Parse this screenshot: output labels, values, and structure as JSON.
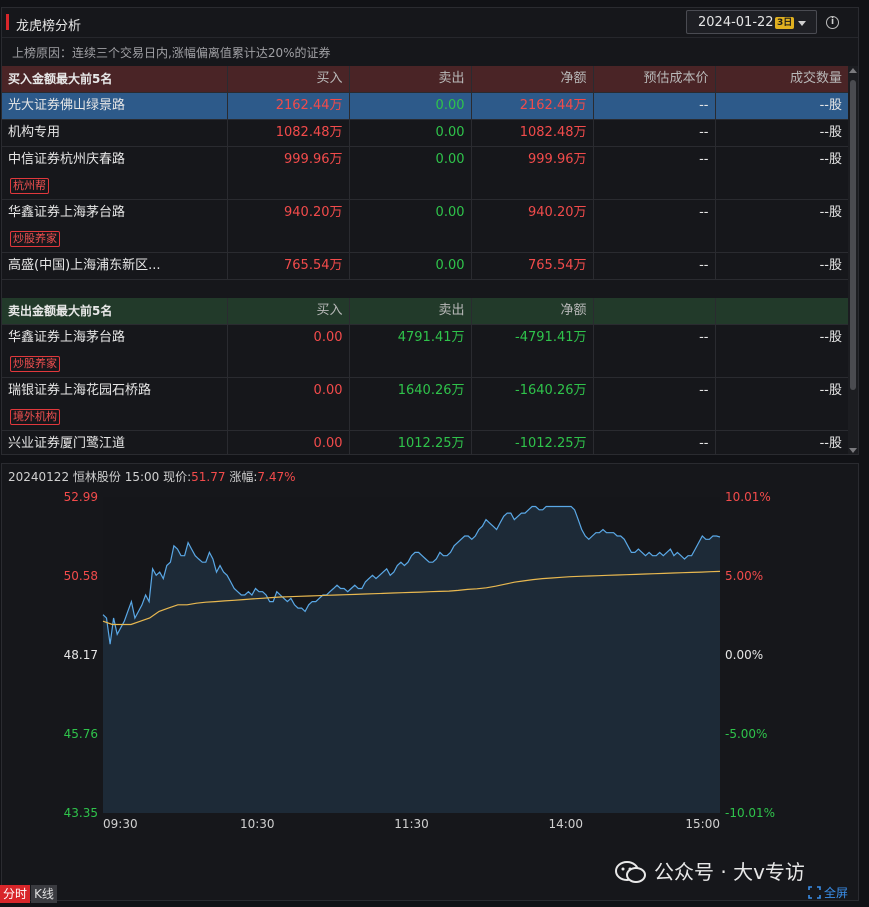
{
  "header": {
    "title": "龙虎榜分析",
    "date": "2024-01-22",
    "days_badge": "3日",
    "info_icon": "info-icon"
  },
  "reason": "上榜原因：连续三个交易日内,涨幅偏离值累计达20%的证券",
  "buy_table": {
    "columns": [
      "买入金额最大前5名",
      "买入",
      "卖出",
      "净额",
      "预估成本价",
      "成交数量"
    ],
    "rows": [
      {
        "name": "光大证券佛山绿景路",
        "tag": "",
        "buy": "2162.44万",
        "sell": "0.00",
        "net": "2162.44万",
        "cost": "--",
        "volume": "--股",
        "selected": true
      },
      {
        "name": "机构专用",
        "tag": "",
        "buy": "1082.48万",
        "sell": "0.00",
        "net": "1082.48万",
        "cost": "--",
        "volume": "--股",
        "selected": false
      },
      {
        "name": "中信证券杭州庆春路",
        "tag": "杭州帮",
        "buy": "999.96万",
        "sell": "0.00",
        "net": "999.96万",
        "cost": "--",
        "volume": "--股",
        "selected": false
      },
      {
        "name": "华鑫证券上海茅台路",
        "tag": "炒股养家",
        "buy": "940.20万",
        "sell": "0.00",
        "net": "940.20万",
        "cost": "--",
        "volume": "--股",
        "selected": false
      },
      {
        "name": "高盛(中国)上海浦东新区...",
        "tag": "",
        "buy": "765.54万",
        "sell": "0.00",
        "net": "765.54万",
        "cost": "--",
        "volume": "--股",
        "selected": false
      }
    ]
  },
  "sell_table": {
    "columns": [
      "卖出金额最大前5名",
      "买入",
      "卖出",
      "净额",
      "",
      ""
    ],
    "rows": [
      {
        "name": "华鑫证券上海茅台路",
        "tag": "炒股养家",
        "buy": "0.00",
        "sell": "4791.41万",
        "net": "-4791.41万",
        "cost": "--",
        "volume": "--股"
      },
      {
        "name": "瑞银证券上海花园石桥路",
        "tag": "境外机构",
        "buy": "0.00",
        "sell": "1640.26万",
        "net": "-1640.26万",
        "cost": "--",
        "volume": "--股"
      },
      {
        "name": "兴业证券厦门鹭江道",
        "tag": "",
        "buy": "0.00",
        "sell": "1012.25万",
        "net": "-1012.25万",
        "cost": "--",
        "volume": "--股"
      }
    ]
  },
  "chart_info": {
    "prefix": "20240122 恒林股份 15:00 现价:",
    "price": "51.77",
    "change_label": "涨幅:",
    "change": "7.47%"
  },
  "chart_data": {
    "type": "line",
    "y_left_ticks": [
      "52.99",
      "50.58",
      "48.17",
      "45.76",
      "43.35"
    ],
    "y_right_ticks": [
      "10.01%",
      "5.00%",
      "0.00%",
      "-5.00%",
      "-10.01%"
    ],
    "x_ticks": [
      "09:30",
      "10:30",
      "11:30",
      "14:00",
      "15:00"
    ],
    "ylim": [
      43.35,
      52.99
    ],
    "prev_close": 48.17,
    "series": [
      {
        "key": "price",
        "values": [
          49.4,
          49.3,
          48.5,
          49.3,
          48.8,
          49.0,
          49.2,
          49.5,
          49.8,
          49.3,
          49.5,
          49.7,
          50.0,
          49.8,
          50.8,
          50.6,
          50.7,
          50.5,
          50.9,
          51.0,
          51.5,
          51.4,
          51.2,
          51.2,
          51.6,
          51.4,
          51.2,
          51.1,
          51.0,
          51.0,
          51.3,
          51.1,
          50.7,
          50.9,
          50.7,
          50.6,
          50.4,
          50.2,
          50.1,
          50.0,
          50.0,
          50.1,
          50.0,
          50.2,
          50.1,
          50.1,
          50.0,
          49.8,
          49.8,
          50.1,
          50.0,
          49.9,
          49.8,
          49.9,
          49.7,
          49.6,
          49.6,
          49.5,
          49.7,
          49.8,
          49.8,
          49.9,
          50.0,
          50.0,
          50.1,
          50.2,
          50.3,
          50.2,
          50.2,
          50.1,
          50.2,
          50.3,
          50.2,
          50.2,
          50.4,
          50.5,
          50.6,
          50.5,
          50.6,
          50.7,
          50.8,
          50.6,
          50.7,
          50.9,
          51.0,
          50.9,
          51.0,
          51.2,
          51.3,
          51.3,
          51.2,
          51.1,
          51.0,
          51.0,
          51.1,
          51.3,
          51.2,
          51.2,
          51.3,
          51.5,
          51.6,
          51.7,
          51.8,
          51.8,
          51.7,
          51.8,
          52.0,
          52.1,
          52.3,
          52.2,
          52.1,
          52.0,
          52.2,
          52.4,
          52.5,
          52.5,
          52.3,
          52.4,
          52.5,
          52.5,
          52.6,
          52.7,
          52.7,
          52.6,
          52.6,
          52.7,
          52.7,
          52.7,
          52.7,
          52.7,
          52.7,
          52.7,
          52.7,
          52.6,
          52.3,
          52.0,
          51.8,
          51.7,
          51.8,
          51.9,
          51.9,
          52.0,
          51.9,
          51.9,
          51.9,
          51.8,
          51.8,
          51.7,
          51.5,
          51.3,
          51.3,
          51.4,
          51.3,
          51.2,
          51.3,
          51.2,
          51.2,
          51.3,
          51.2,
          51.3,
          51.4,
          51.2,
          51.3,
          51.2,
          51.1,
          51.2,
          51.2,
          51.4,
          51.6,
          51.8,
          51.7,
          51.7,
          51.8,
          51.8,
          51.77
        ]
      },
      {
        "key": "average",
        "values": [
          49.2,
          49.1,
          49.1,
          49.1,
          49.2,
          49.3,
          49.5,
          49.6,
          49.7,
          49.7,
          49.75,
          49.78,
          49.8,
          49.82,
          49.84,
          49.86,
          49.88,
          49.9,
          49.92,
          49.94,
          49.95,
          49.96,
          49.97,
          49.98,
          49.99,
          50.0,
          50.01,
          50.02,
          50.03,
          50.04,
          50.05,
          50.06,
          50.07,
          50.08,
          50.09,
          50.1,
          50.11,
          50.12,
          50.14,
          50.17,
          50.19,
          50.22,
          50.27,
          50.33,
          50.39,
          50.43,
          50.47,
          50.5,
          50.52,
          50.54,
          50.56,
          50.57,
          50.58,
          50.59,
          50.6,
          50.61,
          50.62,
          50.63,
          50.64,
          50.65,
          50.66,
          50.67,
          50.68,
          50.69,
          50.7,
          50.71,
          50.72
        ]
      }
    ]
  },
  "bottom": {
    "tab_fenshi": "分时",
    "tab_kline": "K线",
    "watermark": "公众号 · 大v专访",
    "fullscreen": "全屏"
  },
  "colors": {
    "up": "#f24b4b",
    "down": "#2fc34b",
    "price_line": "#5aa8e6",
    "avg_line": "#e8b850",
    "selected_row": "#2d5a8a"
  }
}
